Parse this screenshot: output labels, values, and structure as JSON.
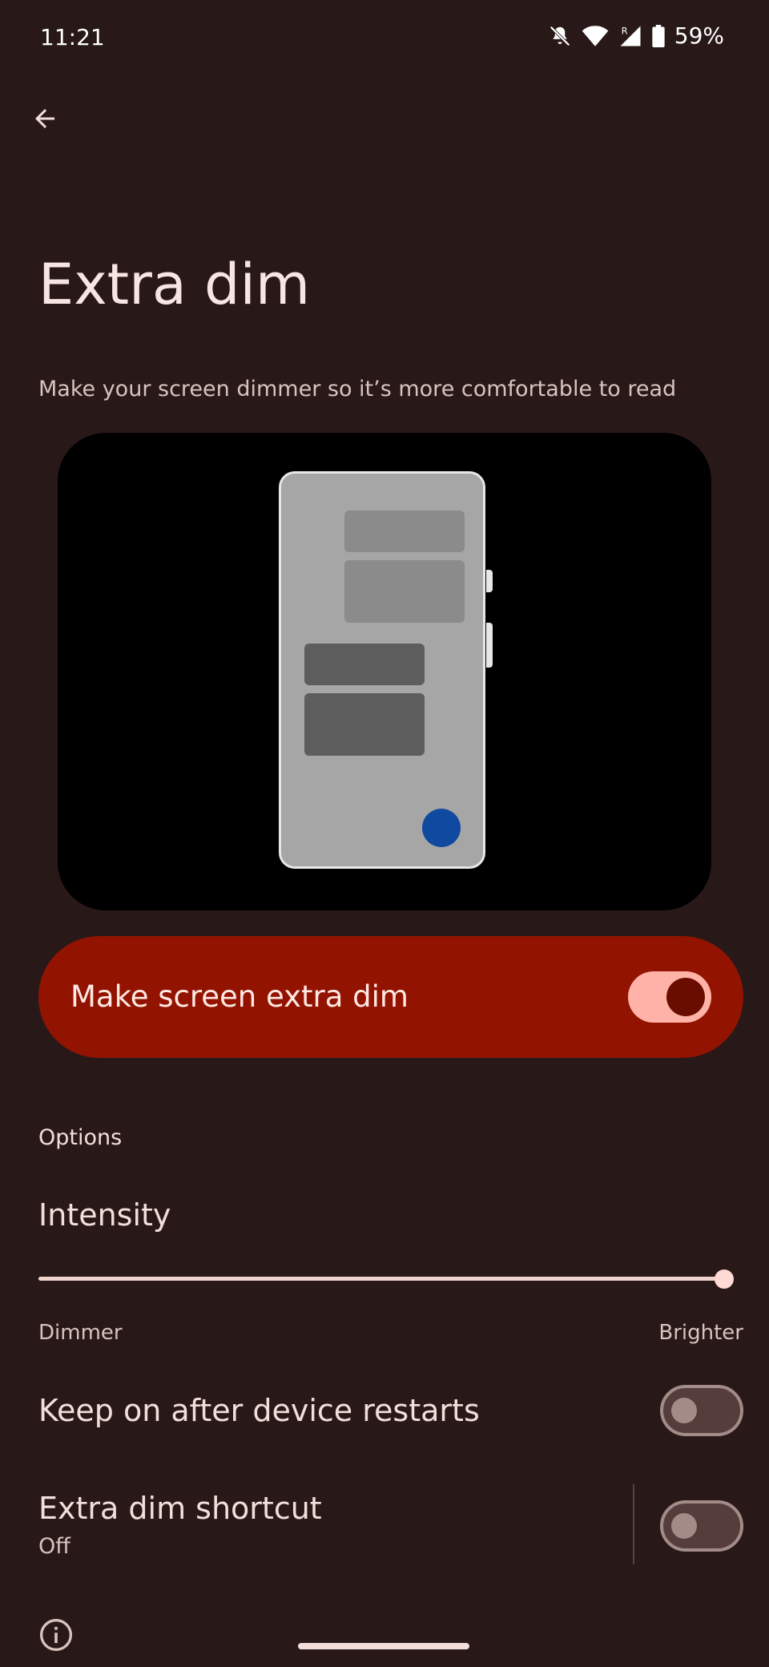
{
  "status_bar": {
    "time": "11:21",
    "battery": "59%",
    "icons": [
      "mute-icon",
      "wifi-icon",
      "signal-roaming-icon",
      "battery-icon"
    ]
  },
  "header": {
    "back_icon": "arrow-back-icon"
  },
  "page": {
    "title": "Extra dim",
    "subtitle": "Make your screen dimmer so it’s more comfortable to read"
  },
  "main_switch": {
    "label": "Make screen extra dim",
    "checked": true
  },
  "options": {
    "header": "Options",
    "intensity": {
      "title": "Intensity",
      "min_label": "Dimmer",
      "max_label": "Brighter",
      "value_fraction": 1.0
    },
    "keep_on": {
      "title": "Keep on after device restarts",
      "checked": false
    },
    "shortcut": {
      "title": "Extra dim shortcut",
      "summary": "Off",
      "checked": false
    }
  },
  "footer": {
    "info_icon": "info-icon"
  },
  "colors": {
    "background": "#281918",
    "accent_card": "#921400",
    "switch_on_track": "#ffb3a8",
    "switch_off_track": "#553d3b"
  }
}
